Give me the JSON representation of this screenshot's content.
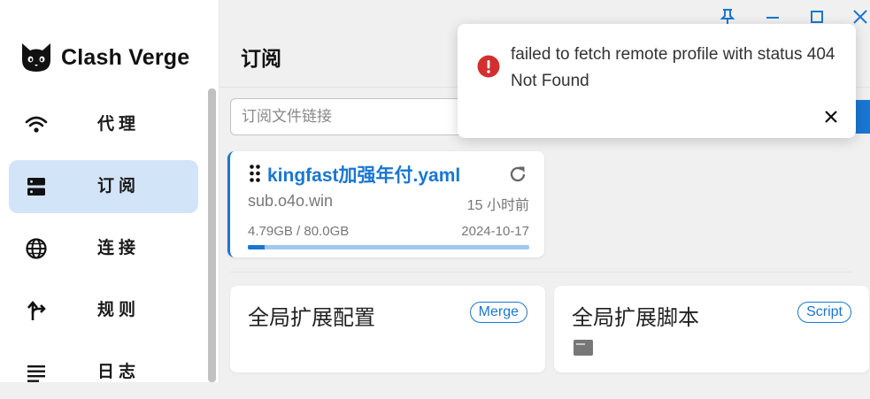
{
  "app": {
    "name": "Clash Verge"
  },
  "sidebar": {
    "items": [
      {
        "label": "代理",
        "icon": "wifi-icon",
        "active": false
      },
      {
        "label": "订阅",
        "icon": "dns-icon",
        "active": true
      },
      {
        "label": "连接",
        "icon": "globe-icon",
        "active": false
      },
      {
        "label": "规则",
        "icon": "fork-arrow-icon",
        "active": false
      },
      {
        "label": "日志",
        "icon": "list-lines-icon",
        "active": false
      }
    ]
  },
  "window_controls": [
    "pin-icon",
    "minimize-icon",
    "maximize-icon",
    "close-icon"
  ],
  "page": {
    "title": "订阅",
    "url_input_placeholder": "订阅文件链接"
  },
  "profile": {
    "name": "kingfast加强年付.yaml",
    "host": "sub.o4o.win",
    "updated": "15 小时前",
    "usage": "4.79GB / 80.0GB",
    "expire": "2024-10-17",
    "usage_fraction": 0.06
  },
  "extensions": [
    {
      "title": "全局扩展配置",
      "badge": "Merge"
    },
    {
      "title": "全局扩展脚本",
      "badge": "Script"
    }
  ],
  "notification": {
    "message": "failed to fetch remote profile with status 404 Not Found"
  },
  "colors": {
    "accent": "#1976d2",
    "active_nav": "#d2e4f8",
    "error": "#d32f2f"
  }
}
